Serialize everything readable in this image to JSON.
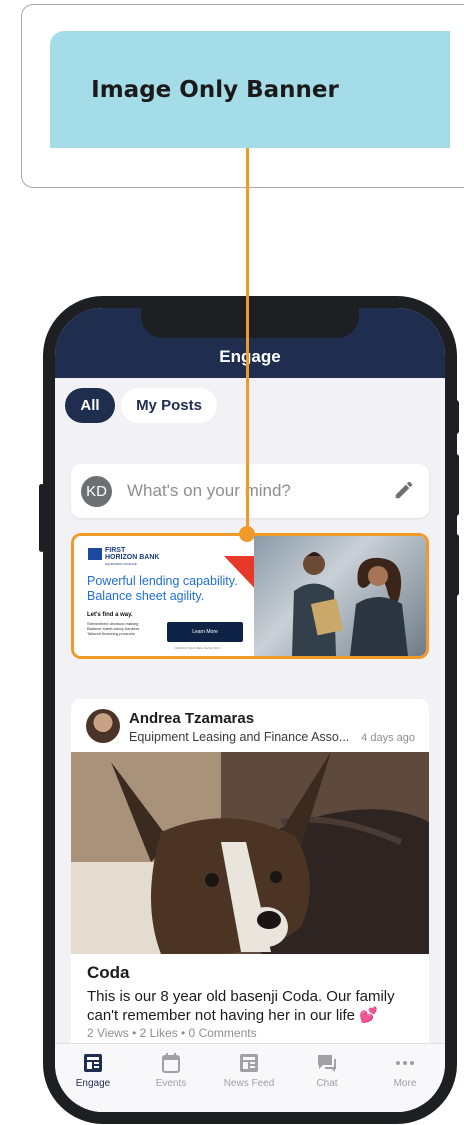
{
  "callout": {
    "label": "Image Only Banner"
  },
  "header": {
    "title": "Engage"
  },
  "filters": {
    "all": "All",
    "my_posts": "My Posts"
  },
  "compose": {
    "initials": "KD",
    "placeholder": "What's on your mind?"
  },
  "ad": {
    "bank_name_line1": "FIRST",
    "bank_name_line2": "HORIZON BANK",
    "bank_subtitle": "EQUIPMENT FINANCE",
    "headline_line1": "Powerful lending capability.",
    "headline_line2": "Balance sheet agility.",
    "find": "Let's find a way.",
    "bullets": [
      "Streamlined decision-making",
      "Balance sheet-savvy bankers",
      "Tailored financing products"
    ],
    "cta": "Learn More",
    "fineprint": "©2023 First Horizon Bank. Member FDIC."
  },
  "post": {
    "author": "Andrea Tzamaras",
    "group": "Equipment Leasing and Finance Asso...",
    "time": "4 days ago",
    "title": "Coda",
    "body": "This is our 8 year old basenji Coda. Our family can't remember not having her in our life 💕",
    "stats": "2 Views  •  2 Likes  •  0 Comments"
  },
  "tabs": [
    {
      "label": "Engage",
      "icon": "engage-icon",
      "active": true
    },
    {
      "label": "Events",
      "icon": "calendar-icon",
      "active": false
    },
    {
      "label": "News Feed",
      "icon": "news-feed-icon",
      "active": false
    },
    {
      "label": "Chat",
      "icon": "chat-icon",
      "active": false
    },
    {
      "label": "More",
      "icon": "more-icon",
      "active": false
    }
  ],
  "colors": {
    "navy": "#1f2d4e",
    "accent_orange": "#f09a2a",
    "callout_bg": "#a4dce8"
  }
}
